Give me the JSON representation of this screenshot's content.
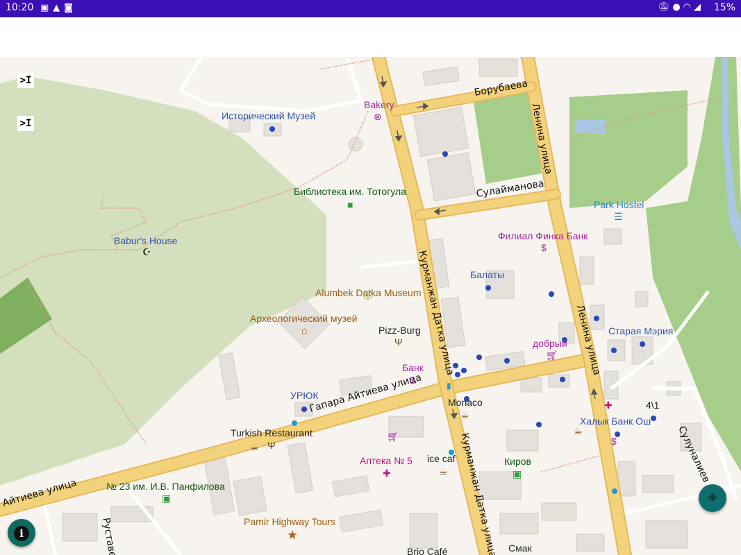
{
  "status_bar": {
    "time": "10:20",
    "left_icons": [
      "image-icon",
      "warning-icon",
      "screenshot-icon"
    ],
    "right_icons": [
      "mute-icon",
      "location-icon",
      "wifi-icon",
      "signal-icon"
    ],
    "battery": "15%"
  },
  "map": {
    "controls": {
      "collapse_top": ">I",
      "collapse_second": ">I",
      "info_button_icon": "info-icon",
      "locate_button_icon": "crosshair-icon"
    },
    "pois": {
      "historical_museum": "Исторический Музей",
      "bakery": "Bakery",
      "library": "Библиотека им. Тотогула",
      "baburs_house": "Babur's House",
      "park_hostel": "Park Hostel",
      "finca_bank": "Филиал Финка Банк",
      "balaty": "Балаты",
      "alumbek_museum": "Alumbek Datka Museum",
      "archaeological_museum": "Археологический музей",
      "pizz_burg": "Pizz-Burg",
      "dobryi": "добрый",
      "old_mayor": "Старая Мэрия",
      "bank": "Банк",
      "uryuk": "УРЮК",
      "monaco": "Monaco",
      "num_4_1": "4\\1",
      "halyk_bank": "Халык Банк Ош",
      "turkish_restaurant": "Turkish Restaurant",
      "pharmacy": "Аптека № 5",
      "ice_cafe": "ice caf",
      "kirov": "Киров",
      "school_23": "№ 23 им. И.В. Панфилова",
      "pamir_tours": "Pamir Highway Tours",
      "brio_cafe": "Brio Café",
      "smak": "Смак"
    },
    "streets": {
      "borubaeva": "Борубаева",
      "lenina_north": "Ленина улица",
      "sulaimanova": "Сулайманова",
      "kurmanjan_north": "Курманжан Датка улица",
      "lenina_south": "Ленина улица",
      "gapara": "Гапара Айтиева улица",
      "aitieva_west": "Айтиева улица",
      "kurmanjan_south": "Курманжан Датка улица",
      "rustaveli": "Руставе",
      "sulunaliev": "Сулуналиев"
    },
    "colors": {
      "background": "#f7f4ef",
      "hill": "#d4dfbd",
      "park": "#a7cd8a",
      "dark_park": "#7fb05d",
      "road_major": "#f3d27c",
      "road_edge": "#e6b85a",
      "building": "#e4e1dc",
      "river": "#a9c6e2",
      "status_bar": "#3b0fb5",
      "fab": "#0e6e6e"
    }
  }
}
